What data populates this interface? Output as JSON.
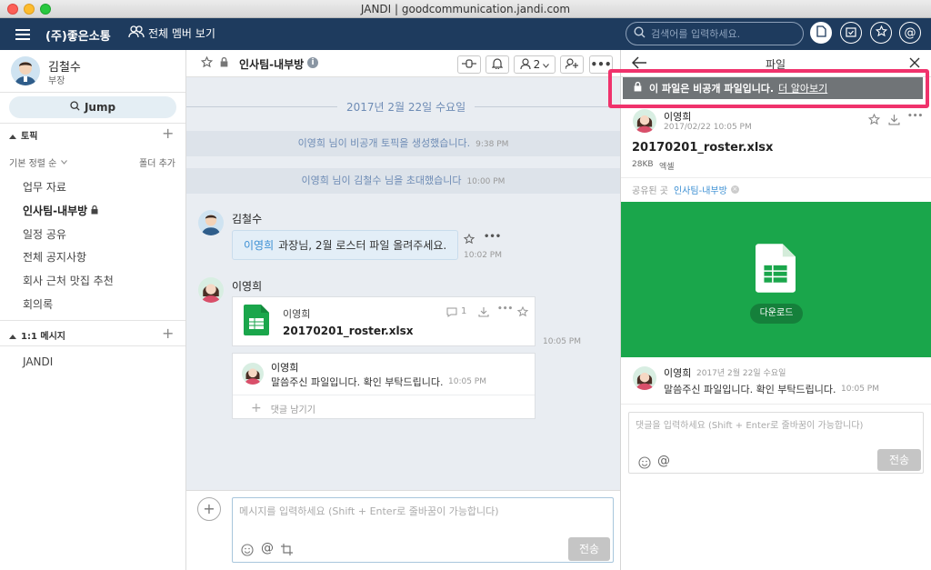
{
  "window": {
    "title": "JANDI | goodcommunication.jandi.com"
  },
  "topnav": {
    "team_name": "(주)좋은소통",
    "members_link": "전체 멤버 보기",
    "search_placeholder": "검색어를 입력하세요.",
    "brand_color": "#1e3b5e"
  },
  "profile": {
    "name": "김철수",
    "role": "부장"
  },
  "sidebar": {
    "jump_label": "Jump",
    "topics_header": "토픽",
    "sort_label": "기본 정렬 순",
    "add_folder": "폴더 추가",
    "topics": [
      "업무 자료",
      "인사팀-내부방",
      "일정 공유",
      "전체 공지사항",
      "회사 근처 맛집 추천",
      "회의록"
    ],
    "active_topic_index": 1,
    "dm_header": "1:1 메시지",
    "dms": [
      "JANDI"
    ]
  },
  "chat": {
    "topic_title": "인사팀-내부방",
    "member_count": "2",
    "date_divider": "2017년 2월 22일 수요일",
    "system_messages": [
      {
        "text": "이영희 님이 비공개 토픽을 생성했습니다.",
        "time": "9:38 PM"
      },
      {
        "text": "이영희 님이 김철수 님을 초대했습니다",
        "time": "10:00 PM"
      }
    ],
    "messages": [
      {
        "sender": "김철수",
        "mention": "이영희",
        "text": "과장님, 2월 로스터 파일 올려주세요.",
        "time": "10:02 PM"
      },
      {
        "sender": "이영희",
        "file_uploader": "이영희",
        "file_name": "20170201_roster.xlsx",
        "comment_count": "1",
        "time": "10:05 PM",
        "comment": {
          "sender": "이영희",
          "text": "말씀주신 파일입니다. 확인 부탁드립니다.",
          "time": "10:05 PM"
        },
        "comment_placeholder": "댓글 남기기"
      }
    ],
    "input_placeholder": "메시지를 입력하세요 (Shift + Enter로 줄바꿈이 가능합니다)",
    "send_label": "전송"
  },
  "panel": {
    "title": "파일",
    "private_notice": "이 파일은 비공개 파일입니다.",
    "learn_more": "더 알아보기",
    "uploader": "이영희",
    "upload_time": "2017/02/22 10:05 PM",
    "file_name": "20170201_roster.xlsx",
    "file_size": "28KB",
    "file_type": "엑셀",
    "shared_label": "공유된 곳",
    "shared_topic": "인사팀-내부방",
    "download_label": "다운로드",
    "preview_color": "#1aa64b",
    "comment": {
      "sender": "이영희",
      "date": "2017년 2월 22일 수요일",
      "text": "말씀주신 파일입니다. 확인 부탁드립니다.",
      "time": "10:05 PM"
    },
    "comment_placeholder": "댓글을 입력하세요 (Shift + Enter로 줄바꿈이 가능합니다)",
    "send_label": "전송",
    "highlight_color": "#f0326c"
  }
}
